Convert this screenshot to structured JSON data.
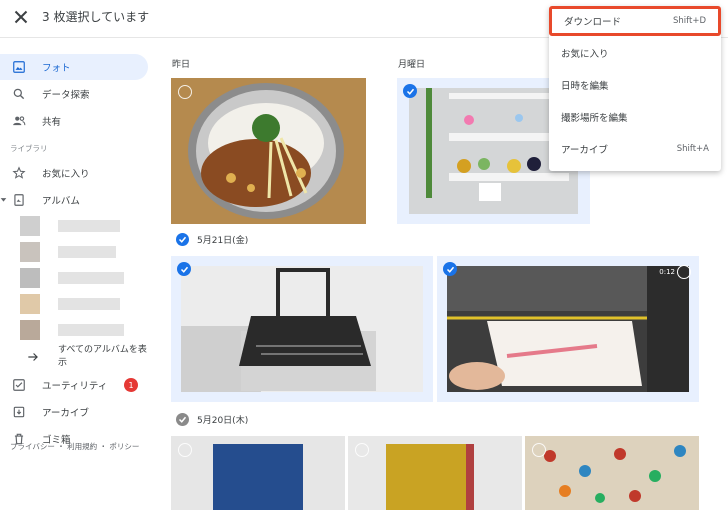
{
  "header": {
    "selection_text": "3 枚選択しています"
  },
  "sidebar": {
    "nav": [
      {
        "label": "フォト",
        "icon": "photo-icon",
        "active": true
      },
      {
        "label": "データ探索",
        "icon": "search-icon"
      },
      {
        "label": "共有",
        "icon": "people-icon"
      }
    ],
    "library_label": "ライブラリ",
    "library": [
      {
        "label": "お気に入り",
        "icon": "star-icon"
      },
      {
        "label": "アルバム",
        "icon": "album-icon"
      }
    ],
    "all_albums_label": "すべてのアルバムを表示",
    "utilities_label": "ユーティリティ",
    "utilities_badge": "1",
    "archive_label": "アーカイブ",
    "trash_label": "ゴミ箱",
    "footer": "プライバシー ・ 利用規約 ・ ポリシー"
  },
  "main": {
    "sections": [
      {
        "label": "昨日"
      },
      {
        "label": "月曜日"
      },
      {
        "label": "5月21日(金)"
      },
      {
        "label": "5月20日(木)"
      }
    ],
    "video_duration": "0:12"
  },
  "menu": {
    "items": [
      {
        "label": "ダウンロード",
        "shortcut": "Shift+D"
      },
      {
        "label": "お気に入り",
        "shortcut": ""
      },
      {
        "label": "日時を編集",
        "shortcut": ""
      },
      {
        "label": "撮影場所を編集",
        "shortcut": ""
      },
      {
        "label": "アーカイブ",
        "shortcut": "Shift+A"
      }
    ]
  },
  "colors": {
    "accent": "#1a73e8",
    "highlight_border": "#e8492b",
    "active_bg": "#e8f0fe",
    "badge": "#e53935"
  }
}
